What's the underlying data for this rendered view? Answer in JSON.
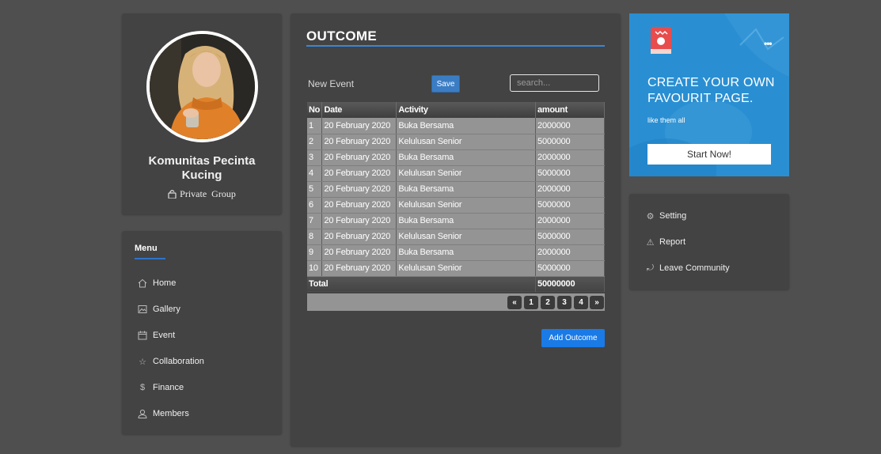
{
  "profile": {
    "name": "Komunitas Pecinta Kucing",
    "group_label": "Private Group"
  },
  "menu": {
    "title": "Menu",
    "items": [
      {
        "label": "Home",
        "icon": "home-icon"
      },
      {
        "label": "Gallery",
        "icon": "gallery-icon"
      },
      {
        "label": "Event",
        "icon": "calendar-icon"
      },
      {
        "label": "Collaboration",
        "icon": "star-icon"
      },
      {
        "label": "Finance",
        "icon": "dollar-icon"
      },
      {
        "label": "Members",
        "icon": "user-icon"
      }
    ]
  },
  "main": {
    "title": "OUTCOME",
    "new_event_label": "New Event",
    "save_label": "Save",
    "search_placeholder": "search...",
    "columns": [
      "No",
      "Date",
      "Activity",
      "amount"
    ],
    "rows": [
      [
        "1",
        "20 February 2020",
        "Buka Bersama",
        "2000000"
      ],
      [
        "2",
        "20 February 2020",
        "Kelulusan Senior",
        "5000000"
      ],
      [
        "3",
        "20 February 2020",
        "Buka Bersama",
        "2000000"
      ],
      [
        "4",
        "20 February 2020",
        "Kelulusan Senior",
        "5000000"
      ],
      [
        "5",
        "20 February 2020",
        "Buka Bersama",
        "2000000"
      ],
      [
        "6",
        "20 February 2020",
        "Kelulusan Senior",
        "5000000"
      ],
      [
        "7",
        "20 February 2020",
        "Buka Bersama",
        "2000000"
      ],
      [
        "8",
        "20 February 2020",
        "Kelulusan Senior",
        "5000000"
      ],
      [
        "9",
        "20 February 2020",
        "Buka Bersama",
        "2000000"
      ],
      [
        "10",
        "20 February 2020",
        "Kelulusan Senior",
        "5000000"
      ]
    ],
    "total_label": "Total",
    "total_value": "50000000",
    "pagination": {
      "prev": "«",
      "pages": [
        "1",
        "2",
        "3",
        "4"
      ],
      "next": "»"
    },
    "add_button_label": "Add Outcome"
  },
  "promo": {
    "menu_dots": "•••",
    "title": "CREATE YOUR OWN FAVOURIT PAGE.",
    "subtitle": "like them all",
    "button_label": "Start Now!",
    "background_color": "#2a8fd2"
  },
  "settings": {
    "items": [
      {
        "label": "Setting",
        "icon": "gear-icon"
      },
      {
        "label": "Report",
        "icon": "warning-icon"
      },
      {
        "label": "Leave Community",
        "icon": "leave-icon"
      }
    ]
  },
  "colors": {
    "page_bg": "#4f4f4f",
    "card_bg": "#434343",
    "accent": "#3a86d6",
    "primary_button": "#1a7ae6"
  }
}
